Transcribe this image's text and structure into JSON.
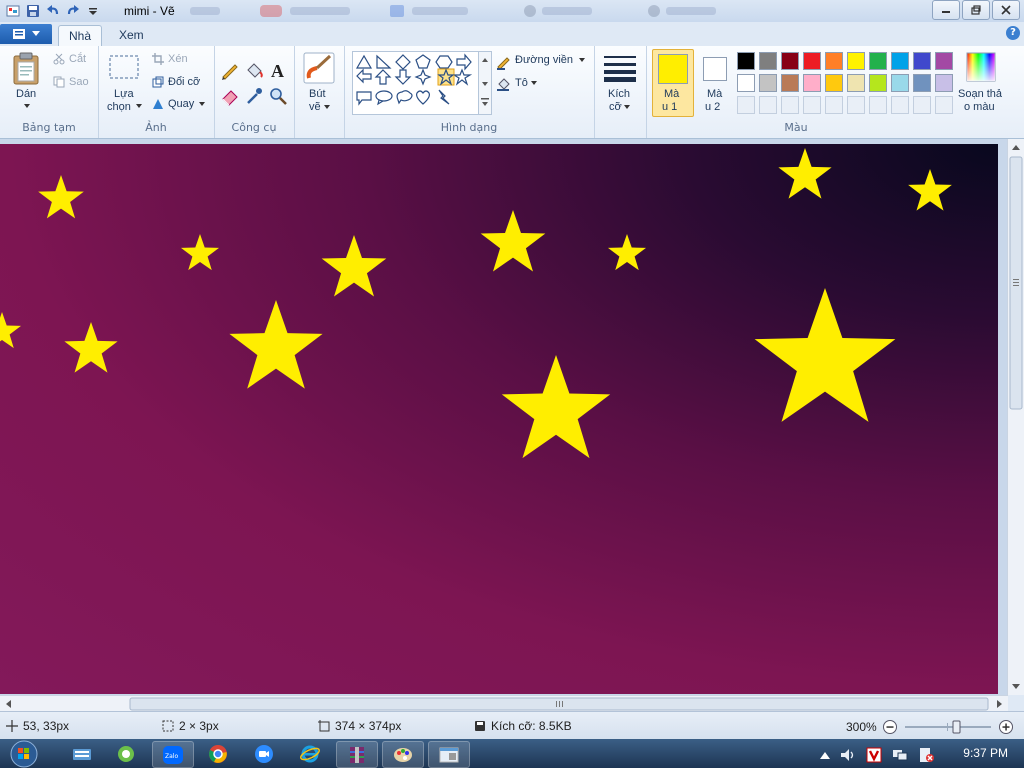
{
  "window": {
    "title": "mimi - Vẽ"
  },
  "tabs": {
    "home": "Nhà",
    "view": "Xem"
  },
  "clipboard": {
    "paste": "Dán",
    "cut": "Cắt",
    "copy": "Sao",
    "group": "Bảng tạm"
  },
  "image": {
    "select_1": "Lựa",
    "select_2": "chọn",
    "crop": "Xén",
    "resize": "Đổi cỡ",
    "rotate": "Quay",
    "group": "Ảnh"
  },
  "tools": {
    "group": "Công cụ"
  },
  "brushes": {
    "label_1": "Bút",
    "label_2": "vẽ"
  },
  "shapes": {
    "outline": "Đường viền",
    "fill": "Tô",
    "group": "Hình dạng"
  },
  "size": {
    "label_1": "Kích",
    "label_2": "cỡ"
  },
  "colors": {
    "color1_1": "Mà",
    "color1_2": "u 1",
    "color2_1": "Mà",
    "color2_2": "u 2",
    "edit_1": "Soạn thả",
    "edit_2": "o màu",
    "group": "Màu",
    "color1_value": "#ffee00",
    "color2_value": "#ffffff",
    "palette_row1": [
      "#000000",
      "#7f7f7f",
      "#880015",
      "#ed1c24",
      "#ff7f27",
      "#fff200",
      "#22b14c",
      "#00a2e8",
      "#3f48cc",
      "#a349a4"
    ],
    "palette_row2": [
      "#ffffff",
      "#c3c3c3",
      "#b97a57",
      "#ffaec9",
      "#ffc90e",
      "#efe4b0",
      "#b5e61d",
      "#99d9ea",
      "#7092be",
      "#c8bfe7"
    ]
  },
  "status": {
    "cursor": "53, 33px",
    "selection": "2 × 3px",
    "image_size": "374 × 374px",
    "file_size": "Kích cỡ: 8.5KB",
    "zoom": "300%"
  },
  "taskbar": {
    "time": "9:37 PM"
  },
  "canvas": {
    "star_color": "#ffee00"
  }
}
